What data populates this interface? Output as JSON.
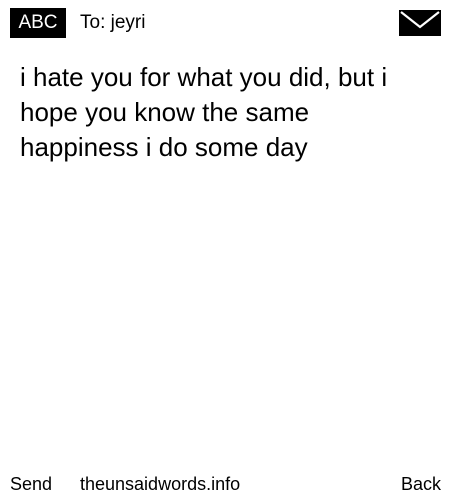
{
  "header": {
    "badge_label": "ABC",
    "to_prefix": "To:",
    "recipient": "jeyri",
    "mail_icon": "envelope-icon"
  },
  "message": {
    "text": "i hate you for what you did, but i hope you know the same happiness i do some day"
  },
  "footer": {
    "send_label": "Send",
    "site_label": "theunsaidwords.info",
    "back_label": "Back"
  },
  "colors": {
    "background": "#ffffff",
    "text": "#000000",
    "badge_background": "#000000",
    "badge_text": "#ffffff"
  }
}
